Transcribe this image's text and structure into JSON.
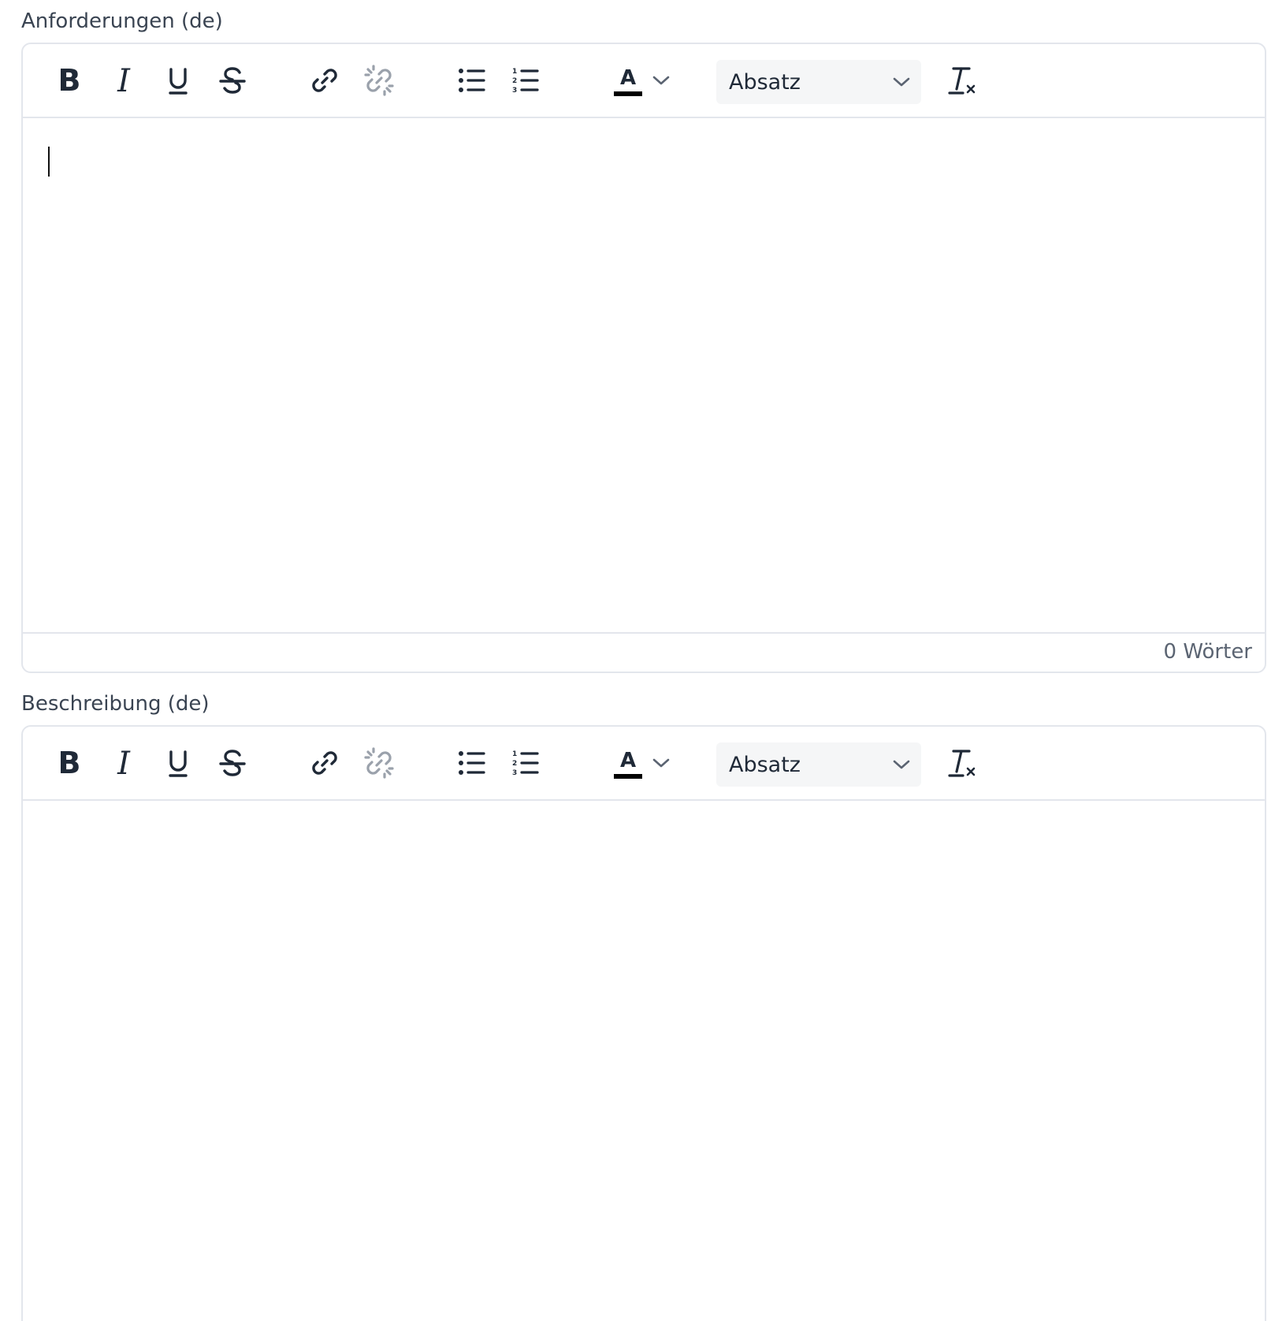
{
  "fields": [
    {
      "label": "Anforderungen (de)",
      "format_value": "Absatz",
      "word_count": "0 Wörter"
    },
    {
      "label": "Beschreibung (de)",
      "format_value": "Absatz"
    }
  ],
  "icons": {
    "bold": "bold-icon",
    "italic": "italic-icon",
    "underline": "underline-icon",
    "strikethrough": "strikethrough-icon",
    "link": "link-icon",
    "unlink": "unlink-icon",
    "bullet_list": "bullet-list-icon",
    "numbered_list": "numbered-list-icon",
    "text_color": "text-color-icon",
    "clear_format": "clear-formatting-icon"
  },
  "colors": {
    "icon": "#1f2937",
    "icon_disabled": "#9aa1ab",
    "border": "#e3e6ec",
    "select_bg": "#f5f6f7",
    "label": "#3a4452",
    "muted": "#5b6472"
  }
}
